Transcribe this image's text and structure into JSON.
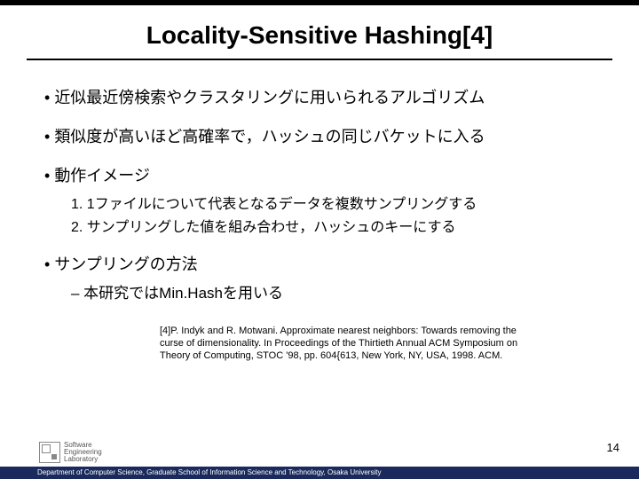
{
  "title": "Locality-Sensitive Hashing[4]",
  "bullets": {
    "b1": "近似最近傍検索やクラスタリングに用いられるアルゴリズム",
    "b2": "類似度が高いほど高確率で，ハッシュの同じバケットに入る",
    "b3": "動作イメージ",
    "b4": "サンプリングの方法"
  },
  "numbered": {
    "n1": "1.   1ファイルについて代表となるデータを複数サンプリングする",
    "n2": "2.   サンプリングした値を組み合わせ，ハッシュのキーにする"
  },
  "dash": "– 本研究ではMin.Hashを用いる",
  "citation_l1": "[4]P. Indyk and R. Motwani. Approximate nearest neighbors: Towards removing the",
  "citation_l2": "curse of dimensionality. In Proceedings of the Thirtieth Annual ACM Symposium on",
  "citation_l3": "Theory of Computing, STOC '98, pp. 604{613, New York, NY, USA, 1998. ACM.",
  "page_num": "14",
  "footer": "Department of Computer Science, Graduate School of Information Science and Technology, Osaka University",
  "logo": {
    "l1": "Software",
    "l2": "Engineering",
    "l3": "Laboratory"
  }
}
